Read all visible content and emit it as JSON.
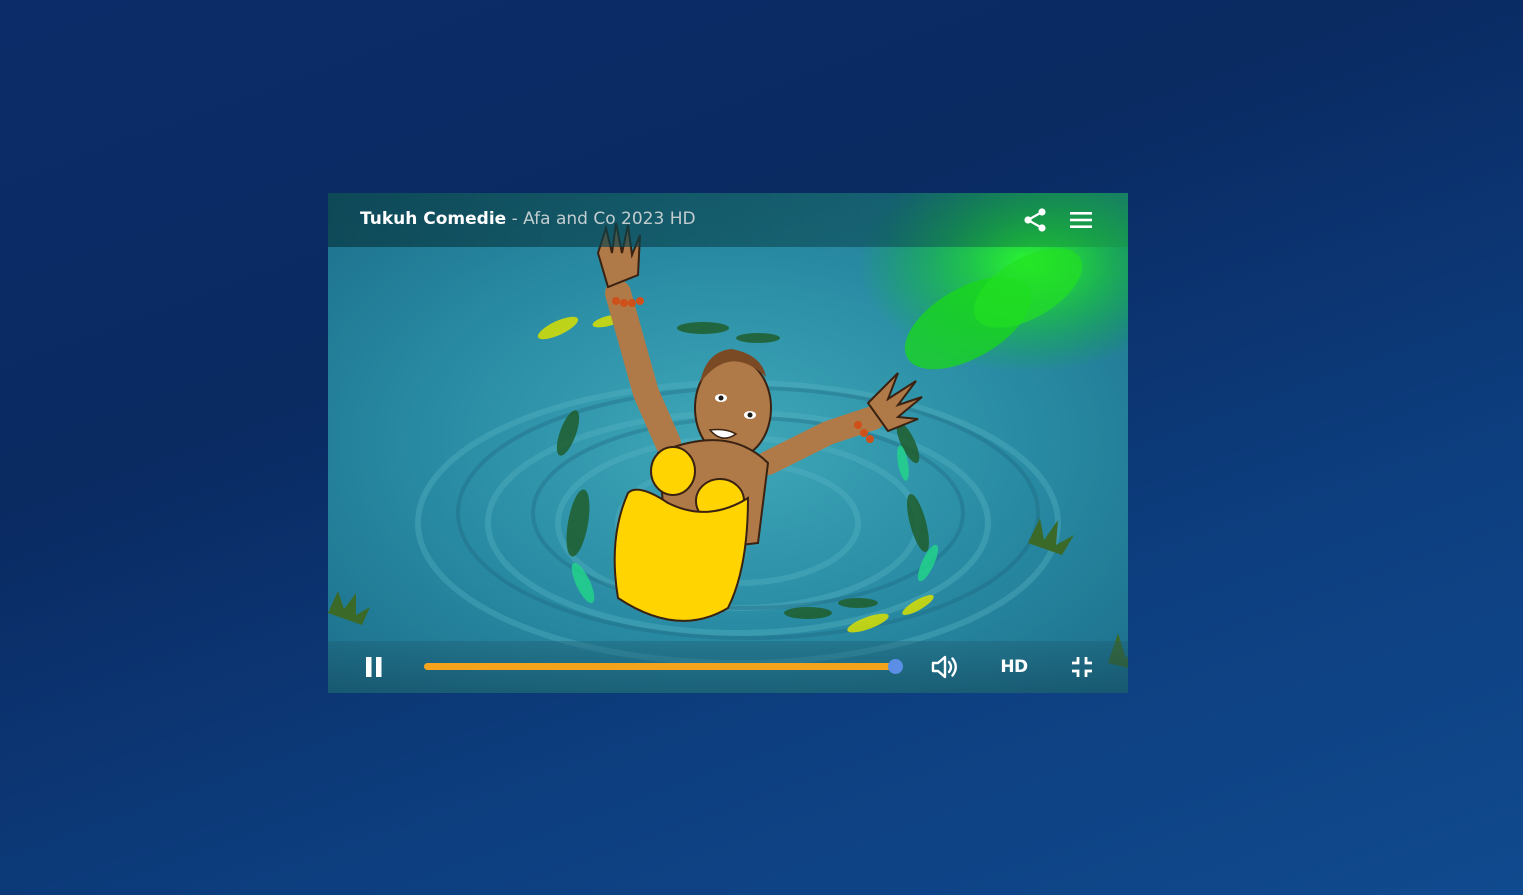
{
  "video": {
    "title": "Tukuh Comedie",
    "subtitle": " - Afa and Co 2023 HD"
  },
  "controls": {
    "share_icon": "share-icon",
    "menu_icon": "hamburger-menu-icon",
    "play_state_icon": "pause-icon",
    "volume_icon": "volume-icon",
    "quality_label": "HD",
    "fullscreen_icon": "exit-fullscreen-icon",
    "progress_fraction": 0.99
  },
  "colors": {
    "page_background": "#0b2c68",
    "progress_fill": "#f5a31c",
    "progress_thumb": "#5b8fe6",
    "title_main": "#ffffff",
    "title_sub": "#c2cdd0"
  }
}
